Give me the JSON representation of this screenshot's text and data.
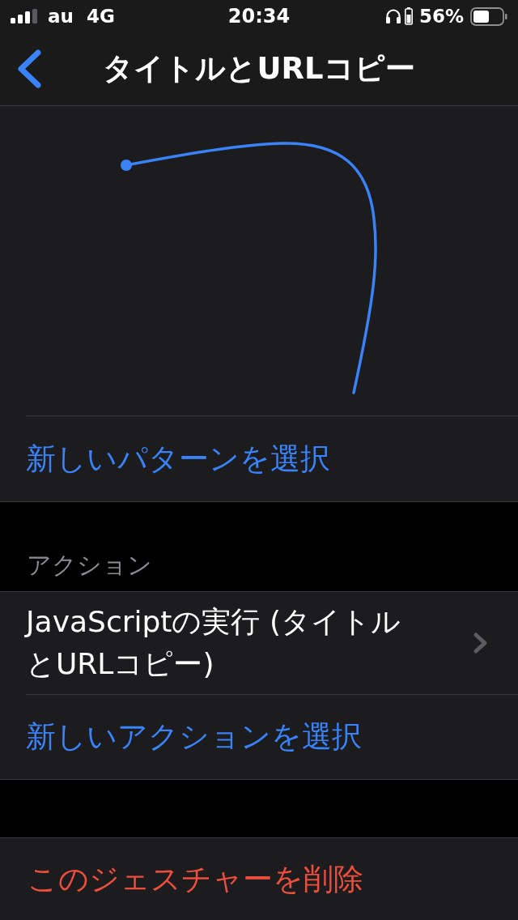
{
  "status_bar": {
    "carrier": "au",
    "network": "4G",
    "time": "20:34",
    "battery_percent": "56%"
  },
  "nav_bar": {
    "title": "タイトルとURLコピー"
  },
  "pattern_section": {
    "choose_button": "新しいパターンを選択"
  },
  "action_section": {
    "header": "アクション",
    "actions": [
      {
        "label": "JavaScriptの実行 (タイトルとURLコピー)"
      }
    ],
    "choose_button": "新しいアクションを選択"
  },
  "delete_button": "このジェスチャーを削除"
}
